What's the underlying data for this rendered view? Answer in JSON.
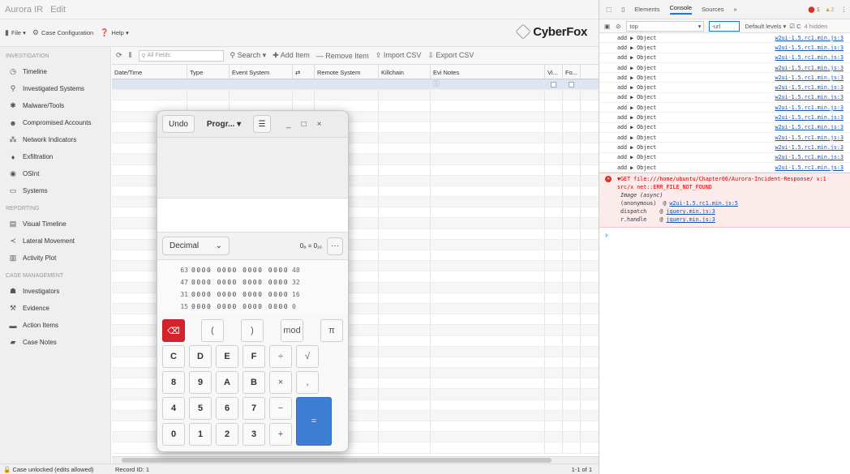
{
  "app": {
    "title": "Aurora IR",
    "menu_edit": "Edit"
  },
  "toolbar": {
    "file": "File",
    "case_config": "Case Configuration",
    "help": "Help",
    "logo": "CyberFox"
  },
  "sidebar": {
    "investigation_label": "INVESTIGATION",
    "investigation": [
      "Timeline",
      "Investigated Systems",
      "Malware/Tools",
      "Compromised Accounts",
      "Network Indicators",
      "Exfiltration",
      "OSInt",
      "Systems"
    ],
    "reporting_label": "REPORTING",
    "reporting": [
      "Visual Timeline",
      "Lateral Movement",
      "Activity Plot"
    ],
    "case_label": "CASE MANAGEMENT",
    "case": [
      "Investigators",
      "Evidence",
      "Action Items",
      "Case Notes"
    ]
  },
  "grid_toolbar": {
    "search_placeholder": "All Fields",
    "search": "Search",
    "add": "Add Item",
    "remove": "Remove Item",
    "import": "Import CSV",
    "export": "Export CSV"
  },
  "columns": [
    "Date/Time",
    "Type",
    "Event System",
    "⇄",
    "Remote System",
    "Killchain",
    "Evi Notes",
    "Vi...",
    "Fo..."
  ],
  "status": {
    "lock": "Case unlocked (edits allowed)",
    "record": "Record ID: 1",
    "page": "1-1 of 1"
  },
  "calculator": {
    "undo": "Undo",
    "mode": "Progr...",
    "menu": "☰",
    "minimize": "_",
    "maximize": "□",
    "close": "×",
    "base": "Decimal",
    "conversion": "0₈ = 0₁₆",
    "more": "···",
    "bit_rows": [
      {
        "left": "63",
        "bits": "0000 0000 0000 0000",
        "right": "48"
      },
      {
        "left": "47",
        "bits": "0000 0000 0000 0000",
        "right": "32"
      },
      {
        "left": "31",
        "bits": "0000 0000 0000 0000",
        "right": "16"
      },
      {
        "left": "15",
        "bits": "0000 0000 0000 0000",
        "right": "0"
      }
    ],
    "keys": {
      "backspace": "⌫",
      "lparen": "(",
      "rparen": ")",
      "mod": "mod",
      "pi": "π",
      "C": "C",
      "D": "D",
      "E": "E",
      "F": "F",
      "div": "÷",
      "sqrt": "√",
      "k8": "8",
      "k9": "9",
      "A": "A",
      "B": "B",
      "mul": "×",
      "comma": ",",
      "k4": "4",
      "k5": "5",
      "k6": "6",
      "k7": "7",
      "minus": "−",
      "k0": "0",
      "k1": "1",
      "k2": "2",
      "k3": "3",
      "plus": "+",
      "equals": "="
    }
  },
  "devtools": {
    "tabs": [
      "Elements",
      "Console",
      "Sources",
      "»"
    ],
    "errors": "1",
    "warnings": "2",
    "context": "top",
    "filter": "-url",
    "levels": "Default levels",
    "hidden": "4 hidden",
    "log_text": "add ▶ Object",
    "log_source": "w2ui-1.5.rc1.min.js:3",
    "error_line1": "▼GET file:///home/ubuntu/Chapter06/Aurora-Incident-Response/ x:1",
    "error_line2": "src/x net::ERR_FILE_NOT_FOUND",
    "stack": [
      "Image (async)",
      "(anonymous)",
      "dispatch",
      "r.handle"
    ],
    "stack_src": [
      "",
      "w2ui-1.5.rc1.min.js:5",
      "jquery.min.js:3",
      "jquery.min.js:3"
    ],
    "prompt": "›"
  }
}
